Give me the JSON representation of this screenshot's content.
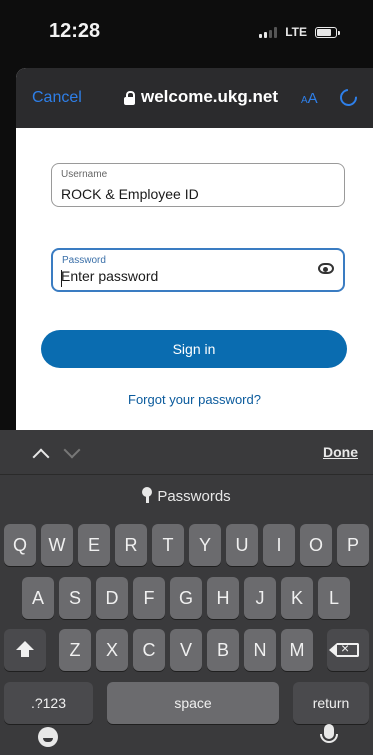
{
  "status_bar": {
    "time": "12:28",
    "network": "LTE"
  },
  "browser": {
    "cancel_label": "Cancel",
    "url": "welcome.ukg.net",
    "text_size_label": "AA"
  },
  "form": {
    "username_label": "Username",
    "username_value": "ROCK & Employee ID",
    "password_label": "Password",
    "password_placeholder": "Enter password",
    "signin_label": "Sign in",
    "forgot_label": "Forgot your password?"
  },
  "keyboard": {
    "done_label": "Done",
    "passwords_label": "Passwords",
    "row1": [
      "Q",
      "W",
      "E",
      "R",
      "T",
      "Y",
      "U",
      "I",
      "O",
      "P"
    ],
    "row2": [
      "A",
      "S",
      "D",
      "F",
      "G",
      "H",
      "J",
      "K",
      "L"
    ],
    "row3": [
      "Z",
      "X",
      "C",
      "V",
      "B",
      "N",
      "M"
    ],
    "numbers_label": ".?123",
    "space_label": "space",
    "return_label": "return"
  },
  "colors": {
    "accent": "#0a6cb0",
    "link": "#2e7fe8",
    "focus": "#3a7cc2"
  }
}
